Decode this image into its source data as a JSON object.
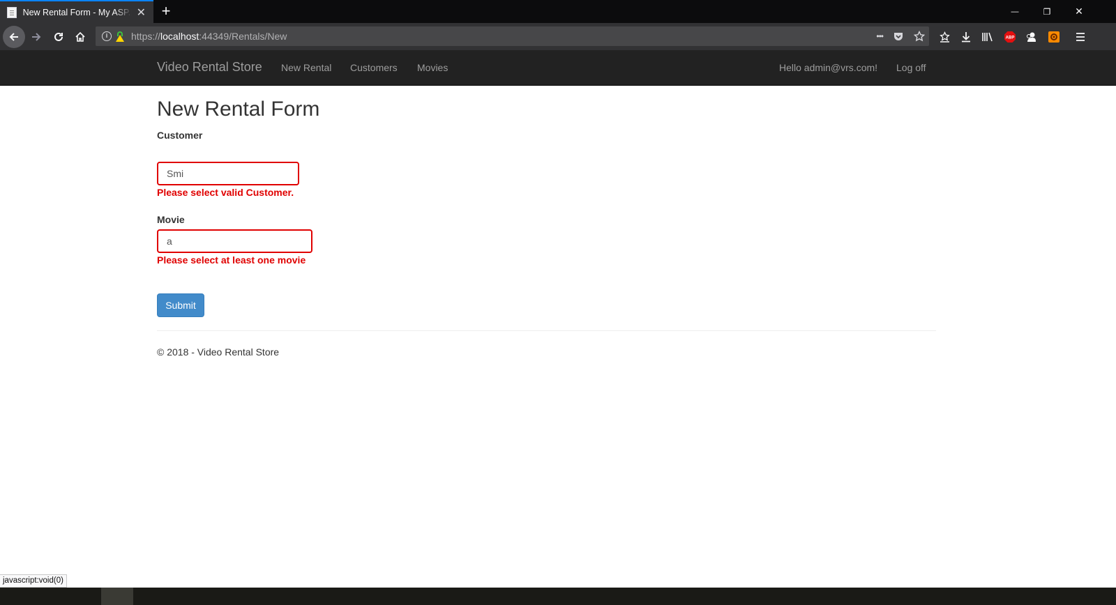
{
  "browser": {
    "tab_title": "New Rental Form - My ASP.NET Application",
    "tab_close": "✕",
    "new_tab": "+",
    "url_scheme": "https://",
    "url_host": "localhost",
    "url_path": ":44349/Rentals/New",
    "page_actions": "•••",
    "window_controls": {
      "minimize": "—",
      "restore": "❐",
      "close": "✕"
    }
  },
  "navbar": {
    "brand": "Video Rental Store",
    "links": [
      "New Rental",
      "Customers",
      "Movies"
    ],
    "greeting": "Hello admin@vrs.com!",
    "logoff": "Log off"
  },
  "form": {
    "title": "New Rental Form",
    "customer": {
      "label": "Customer",
      "value": "Smi",
      "error": "Please select valid Customer."
    },
    "movie": {
      "label": "Movie",
      "value": "a",
      "error": "Please select at least one movie"
    },
    "submit_label": "Submit"
  },
  "footer": {
    "text": "© 2018 - Video Rental Store"
  },
  "status_bar": {
    "text": "javascript:void(0)"
  },
  "colors": {
    "navbar": "#222222",
    "error": "#e00000",
    "button": "#428bca"
  }
}
